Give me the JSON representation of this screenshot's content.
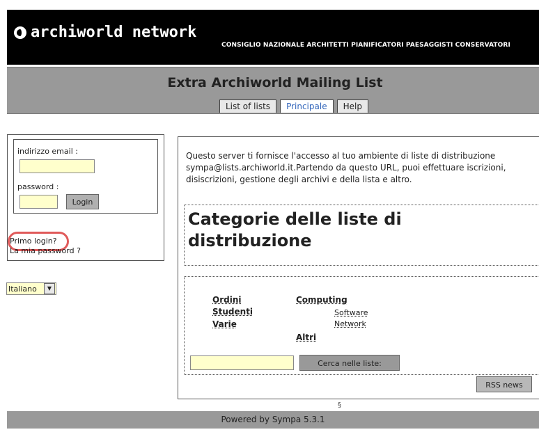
{
  "header": {
    "logo_text": "archiworld network",
    "subtitle": "CONSIGLIO NAZIONALE ARCHITETTI PIANIFICATORI PAESAGGISTI CONSERVATORI"
  },
  "list_title": "Extra Archiworld Mailing List",
  "tabs": [
    {
      "label": "List of lists",
      "active": false
    },
    {
      "label": "Principale",
      "active": true
    },
    {
      "label": "Help",
      "active": false
    }
  ],
  "login": {
    "email_label": "indirizzo email :",
    "email_value": "",
    "password_label": "password :",
    "password_value": "",
    "login_button": "Login",
    "first_login_link": "Primo login?",
    "my_password_link": "La mia password ?"
  },
  "language": {
    "selected": "Italiano"
  },
  "intro_text": "Questo server ti fornisce l'accesso al tuo ambiente di liste di distribuzione sympa@lists.archiworld.it.Partendo da questo URL, puoi effettuare iscrizioni, disiscrizioni, gestione degli archivi e della lista e altro.",
  "categories": {
    "title": "Categorie delle liste di distribuzione",
    "ordini": "Ordini",
    "studenti": "Studenti",
    "varie": "Varie",
    "computing": "Computing",
    "software": "Software",
    "network": "Network",
    "altri": "Altri"
  },
  "search": {
    "value": "",
    "button": "Cerca nelle liste:"
  },
  "rss_button": "RSS news",
  "section_mark": "§",
  "footer": "Powered by Sympa 5.3.1",
  "colors": {
    "header_bg": "#000000",
    "banner_bg": "#999999",
    "input_bg": "#ffffcc",
    "active_tab_text": "#3366bb",
    "highlight": "#e05a5a"
  }
}
